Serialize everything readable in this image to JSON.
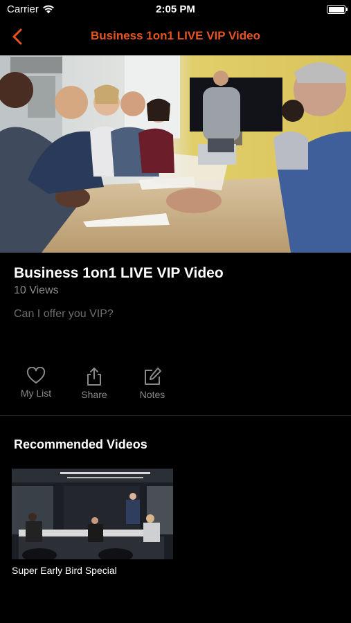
{
  "status_bar": {
    "carrier": "Carrier",
    "time": "2:05 PM"
  },
  "nav": {
    "title": "Business 1on1 LIVE VIP Video",
    "accent_color": "#e8531f"
  },
  "video": {
    "title": "Business 1on1 LIVE VIP Video",
    "views": "10 Views",
    "description": "Can I offer you VIP?"
  },
  "actions": {
    "my_list": "My List",
    "share": "Share",
    "notes": "Notes"
  },
  "recommended": {
    "section_title": "Recommended Videos",
    "items": [
      {
        "title": "Super Early Bird Special"
      }
    ]
  }
}
